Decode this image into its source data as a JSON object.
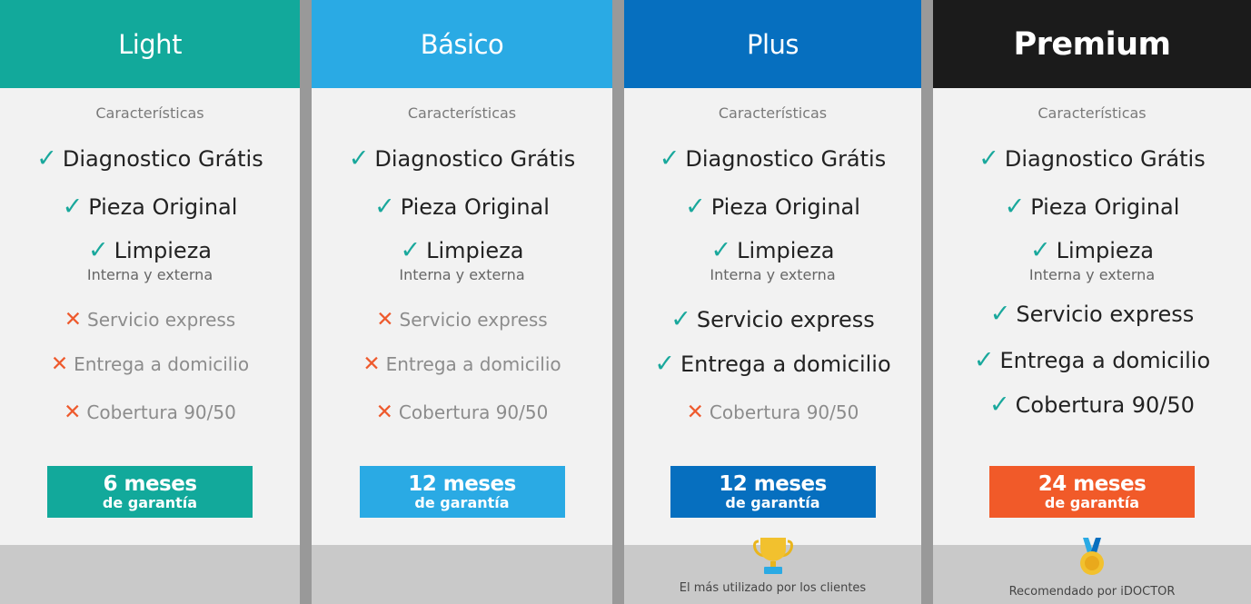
{
  "plans": [
    {
      "name": "Light",
      "header_color": "#12a99b",
      "features_title": "Características",
      "features": [
        {
          "label": "Diagnostico Grátis",
          "included": true
        },
        {
          "label": "Pieza Original",
          "included": true
        },
        {
          "label": "Limpieza",
          "sublabel": "Interna y externa",
          "included": true
        },
        {
          "label": "Servicio express",
          "included": false
        },
        {
          "label": "Entrega a domicilio",
          "included": false
        },
        {
          "label": "Cobertura 90/50",
          "included": false
        }
      ],
      "warranty": {
        "big": "6 meses",
        "small": "de garantía",
        "color": "#12a99b"
      },
      "footer": null
    },
    {
      "name": "Básico",
      "header_color": "#2aaae4",
      "features_title": "Características",
      "features": [
        {
          "label": "Diagnostico Grátis",
          "included": true
        },
        {
          "label": "Pieza Original",
          "included": true
        },
        {
          "label": "Limpieza",
          "sublabel": "Interna y externa",
          "included": true
        },
        {
          "label": "Servicio express",
          "included": false
        },
        {
          "label": "Entrega a domicilio",
          "included": false
        },
        {
          "label": "Cobertura 90/50",
          "included": false
        }
      ],
      "warranty": {
        "big": "12 meses",
        "small": "de garantía",
        "color": "#2aaae4"
      },
      "footer": null
    },
    {
      "name": "Plus",
      "header_color": "#066fbf",
      "features_title": "Características",
      "features": [
        {
          "label": "Diagnostico Grátis",
          "included": true
        },
        {
          "label": "Pieza Original",
          "included": true
        },
        {
          "label": "Limpieza",
          "sublabel": "Interna y externa",
          "included": true
        },
        {
          "label": "Servicio express",
          "included": true
        },
        {
          "label": "Entrega a domicilio",
          "included": true
        },
        {
          "label": "Cobertura 90/50",
          "included": false
        }
      ],
      "warranty": {
        "big": "12 meses",
        "small": "de garantía",
        "color": "#066fbf"
      },
      "footer": {
        "icon": "trophy-icon",
        "caption": "El más utilizado por los clientes"
      }
    },
    {
      "name": "Premium",
      "header_color": "#1b1b1b",
      "features_title": "Características",
      "features": [
        {
          "label": "Diagnostico Grátis",
          "included": true
        },
        {
          "label": "Pieza Original",
          "included": true
        },
        {
          "label": "Limpieza",
          "sublabel": "Interna y externa",
          "included": true
        },
        {
          "label": "Servicio express",
          "included": true
        },
        {
          "label": "Entrega a domicilio",
          "included": true
        },
        {
          "label": "Cobertura 90/50",
          "included": true
        }
      ],
      "warranty": {
        "big": "24 meses",
        "small": "de garantía",
        "color": "#f15a29"
      },
      "footer": {
        "icon": "medal-icon",
        "caption": "Recomendado por iDOCTOR"
      }
    }
  ],
  "colors": {
    "check": "#19a89c",
    "cross": "#ee5a2d"
  }
}
